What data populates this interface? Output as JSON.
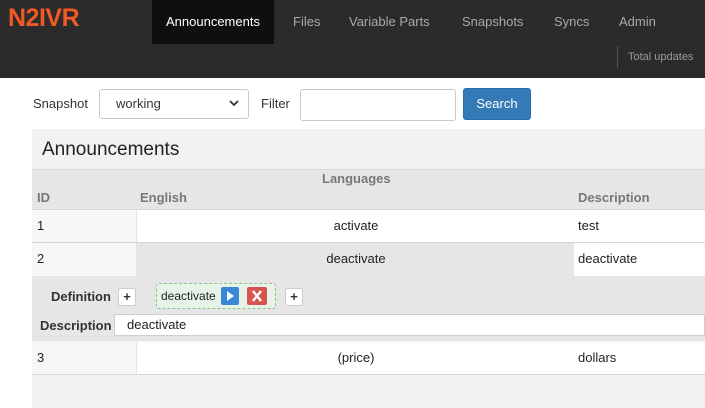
{
  "brand": "N2IVR",
  "nav": {
    "items": [
      "Announcements",
      "Files",
      "Variable Parts",
      "Snapshots",
      "Syncs",
      "Admin"
    ],
    "active": "Announcements",
    "sub_label": "Total updates"
  },
  "toolbar": {
    "snapshot_label": "Snapshot",
    "snapshot_value": "working",
    "filter_label": "Filter",
    "filter_value": "",
    "search_label": "Search"
  },
  "panel": {
    "title": "Announcements",
    "group_header": "Languages",
    "columns": {
      "id": "ID",
      "english": "English",
      "description": "Description"
    },
    "rows": [
      {
        "id": "1",
        "english": "activate",
        "description": "test"
      },
      {
        "id": "2",
        "english": "deactivate",
        "description": "deactivate"
      },
      {
        "id": "3",
        "english": "(price)",
        "description": "dollars"
      }
    ],
    "detail": {
      "definition_label": "Definition",
      "definition_tag": "deactivate",
      "description_label": "Description",
      "description_value": "deactivate",
      "add_symbol": "+"
    }
  },
  "colors": {
    "navbar": "#2b2b2b",
    "brand": "#f15a24",
    "search_button": "#337ab7",
    "play_button": "#3a87d6",
    "delete_button": "#d9534f"
  }
}
